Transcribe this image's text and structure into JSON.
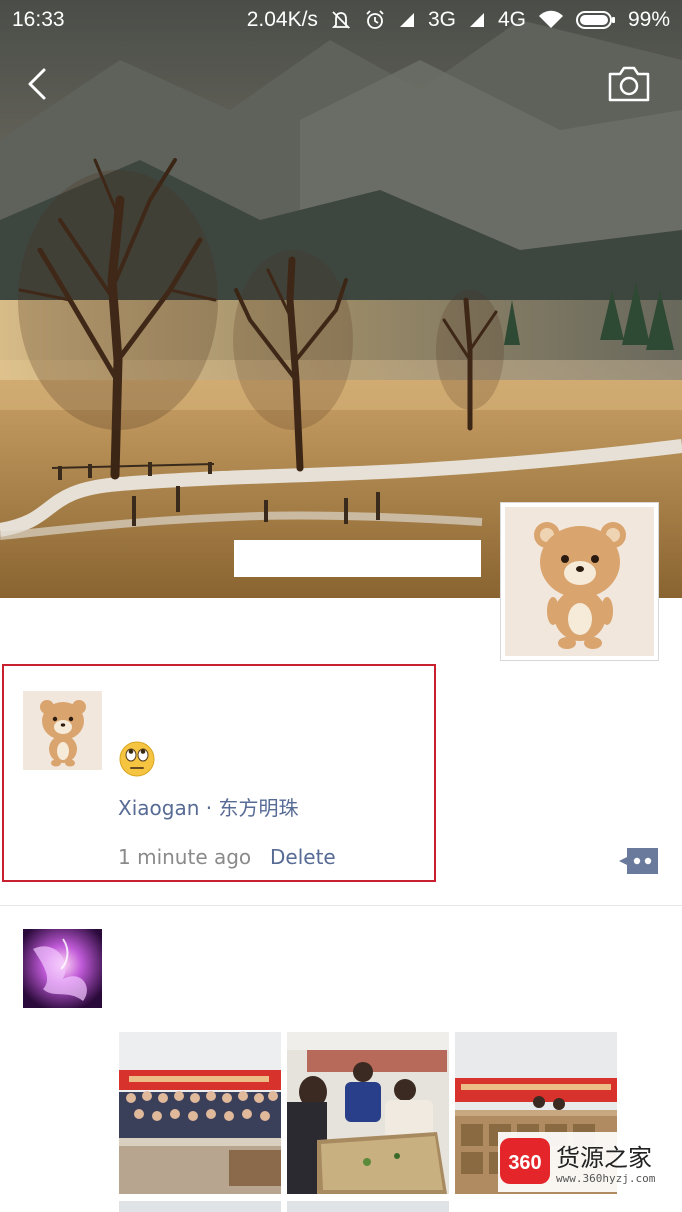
{
  "status_bar": {
    "time": "16:33",
    "network_speed": "2.04K/s",
    "sim1_type": "3G",
    "sim2_type": "4G",
    "battery": "99%",
    "icons": [
      "mute-icon",
      "alarm-icon",
      "signal-icon",
      "signal-icon",
      "wifi-icon",
      "battery-icon"
    ]
  },
  "header": {
    "back_icon": "chevron-left-icon",
    "camera_icon": "camera-icon"
  },
  "posts": [
    {
      "emoji": "face-with-rolling-eyes",
      "location": "Xiaogan · 东方明珠",
      "time_ago": "1 minute ago",
      "delete_label": "Delete",
      "comment_icon": "comment-dots-icon"
    },
    {
      "photos": [
        "group-photo",
        "classroom-sandbox-photo",
        "banner-room-photo"
      ]
    }
  ],
  "watermark": {
    "logo_text": "360",
    "title": "货源之家",
    "url": "www.360hyzj.com"
  },
  "colors": {
    "link": "#576b95",
    "meta": "#8a8a8a",
    "highlight_border": "#c8202f",
    "watermark_red": "#e4262a"
  }
}
